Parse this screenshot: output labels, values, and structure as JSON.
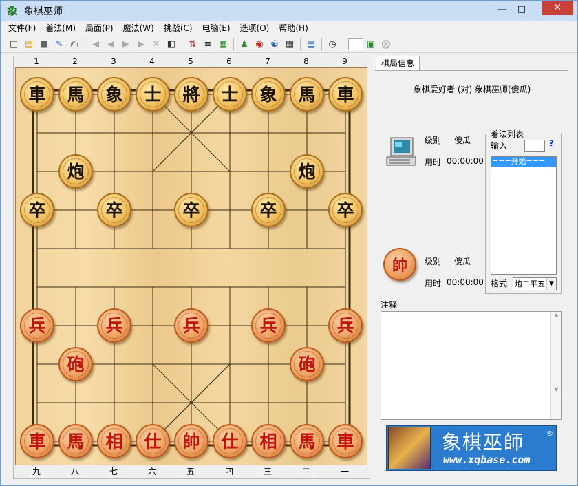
{
  "window": {
    "title": "象棋巫师",
    "icon_glyph": "象"
  },
  "menu": [
    "文件(F)",
    "着法(M)",
    "局面(P)",
    "魔法(W)",
    "挑战(C)",
    "电脑(E)",
    "选项(O)",
    "帮助(H)"
  ],
  "toolbar": {
    "icons": [
      "new-file-icon",
      "open-folder-icon",
      "save-icon",
      "edit-icon",
      "print-icon",
      "first-move-icon",
      "prev-move-icon",
      "next-move-icon",
      "last-move-icon",
      "delete-icon",
      "copy-board-icon",
      "flip-icon",
      "move-list-icon",
      "calculator-icon",
      "engine-person-icon",
      "eye-icon",
      "browser-icon",
      "book-icon",
      "help-book-icon",
      "clock-icon",
      "monitor-icon",
      "stop-icon"
    ]
  },
  "board": {
    "files_top": [
      "1",
      "2",
      "3",
      "4",
      "5",
      "6",
      "7",
      "8",
      "9"
    ],
    "files_bottom": [
      "九",
      "八",
      "七",
      "六",
      "五",
      "四",
      "三",
      "二",
      "一"
    ],
    "pieces": [
      {
        "char": "車",
        "side": "black",
        "file": 0,
        "rank": 0
      },
      {
        "char": "馬",
        "side": "black",
        "file": 1,
        "rank": 0
      },
      {
        "char": "象",
        "side": "black",
        "file": 2,
        "rank": 0
      },
      {
        "char": "士",
        "side": "black",
        "file": 3,
        "rank": 0
      },
      {
        "char": "將",
        "side": "black",
        "file": 4,
        "rank": 0
      },
      {
        "char": "士",
        "side": "black",
        "file": 5,
        "rank": 0
      },
      {
        "char": "象",
        "side": "black",
        "file": 6,
        "rank": 0
      },
      {
        "char": "馬",
        "side": "black",
        "file": 7,
        "rank": 0
      },
      {
        "char": "車",
        "side": "black",
        "file": 8,
        "rank": 0
      },
      {
        "char": "炮",
        "side": "black",
        "file": 1,
        "rank": 2
      },
      {
        "char": "炮",
        "side": "black",
        "file": 7,
        "rank": 2
      },
      {
        "char": "卒",
        "side": "black",
        "file": 0,
        "rank": 3
      },
      {
        "char": "卒",
        "side": "black",
        "file": 2,
        "rank": 3
      },
      {
        "char": "卒",
        "side": "black",
        "file": 4,
        "rank": 3
      },
      {
        "char": "卒",
        "side": "black",
        "file": 6,
        "rank": 3
      },
      {
        "char": "卒",
        "side": "black",
        "file": 8,
        "rank": 3
      },
      {
        "char": "兵",
        "side": "red",
        "file": 0,
        "rank": 6
      },
      {
        "char": "兵",
        "side": "red",
        "file": 2,
        "rank": 6
      },
      {
        "char": "兵",
        "side": "red",
        "file": 4,
        "rank": 6
      },
      {
        "char": "兵",
        "side": "red",
        "file": 6,
        "rank": 6
      },
      {
        "char": "兵",
        "side": "red",
        "file": 8,
        "rank": 6
      },
      {
        "char": "砲",
        "side": "red",
        "file": 1,
        "rank": 7
      },
      {
        "char": "砲",
        "side": "red",
        "file": 7,
        "rank": 7
      },
      {
        "char": "車",
        "side": "red",
        "file": 0,
        "rank": 9
      },
      {
        "char": "馬",
        "side": "red",
        "file": 1,
        "rank": 9
      },
      {
        "char": "相",
        "side": "red",
        "file": 2,
        "rank": 9
      },
      {
        "char": "仕",
        "side": "red",
        "file": 3,
        "rank": 9
      },
      {
        "char": "帥",
        "side": "red",
        "file": 4,
        "rank": 9
      },
      {
        "char": "仕",
        "side": "red",
        "file": 5,
        "rank": 9
      },
      {
        "char": "相",
        "side": "red",
        "file": 6,
        "rank": 9
      },
      {
        "char": "馬",
        "side": "red",
        "file": 7,
        "rank": 9
      },
      {
        "char": "車",
        "side": "red",
        "file": 8,
        "rank": 9
      }
    ]
  },
  "panel": {
    "tab_label": "棋局信息",
    "matchup": "象棋爱好者 (对) 象棋巫师(傻瓜)",
    "top_player": {
      "level_label": "级别",
      "level_value": "傻瓜",
      "time_label": "用时",
      "time_value": "00:00:00"
    },
    "bottom_player": {
      "avatar_char": "帥",
      "level_label": "级别",
      "level_value": "傻瓜",
      "time_label": "用时",
      "time_value": "00:00:00"
    },
    "moves": {
      "title": "着法列表",
      "input_label": "输入",
      "help_link": "?",
      "list": [
        "===开始==="
      ],
      "format_label": "格式",
      "format_value": "炮二平五"
    },
    "notes_label": "注释",
    "banner": {
      "title": "象棋巫師",
      "reg": "®",
      "url": "www.xqbase.com"
    }
  }
}
